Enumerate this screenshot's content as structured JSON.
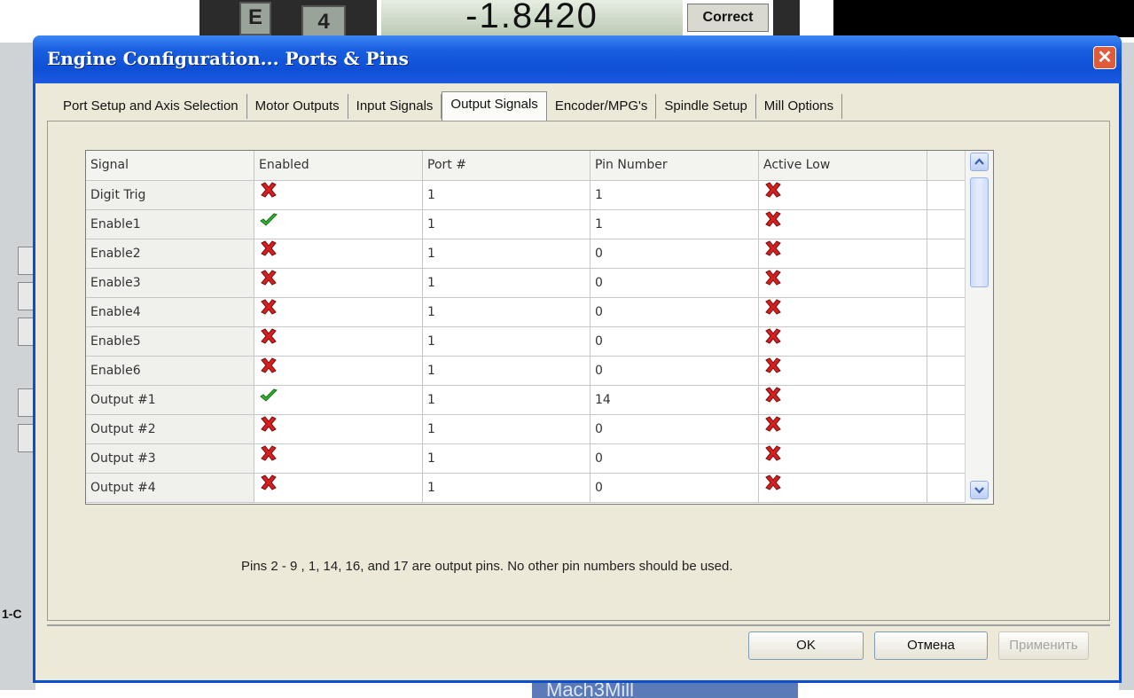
{
  "background_app": {
    "segment_letter": "E",
    "segment_digit": "4",
    "dro_value": "-1.8420",
    "correct_label": "Correct",
    "left_partial_text": "1-C",
    "bottom_label": "Mach3Mill"
  },
  "dialog": {
    "title": "Engine Configuration... Ports & Pins",
    "close_symbol": "✕",
    "tabs": [
      {
        "label": "Port Setup and Axis Selection",
        "active": false
      },
      {
        "label": "Motor Outputs",
        "active": false
      },
      {
        "label": "Input Signals",
        "active": false
      },
      {
        "label": "Output Signals",
        "active": true
      },
      {
        "label": "Encoder/MPG's",
        "active": false
      },
      {
        "label": "Spindle Setup",
        "active": false
      },
      {
        "label": "Mill Options",
        "active": false
      }
    ],
    "grid": {
      "headers": [
        "Signal",
        "Enabled",
        "Port #",
        "Pin Number",
        "Active Low"
      ],
      "rows": [
        {
          "signal": "Digit Trig",
          "enabled": false,
          "port": "1",
          "pin": "1",
          "active_low": false
        },
        {
          "signal": "Enable1",
          "enabled": true,
          "port": "1",
          "pin": "1",
          "active_low": false
        },
        {
          "signal": "Enable2",
          "enabled": false,
          "port": "1",
          "pin": "0",
          "active_low": false
        },
        {
          "signal": "Enable3",
          "enabled": false,
          "port": "1",
          "pin": "0",
          "active_low": false
        },
        {
          "signal": "Enable4",
          "enabled": false,
          "port": "1",
          "pin": "0",
          "active_low": false
        },
        {
          "signal": "Enable5",
          "enabled": false,
          "port": "1",
          "pin": "0",
          "active_low": false
        },
        {
          "signal": "Enable6",
          "enabled": false,
          "port": "1",
          "pin": "0",
          "active_low": false
        },
        {
          "signal": "Output #1",
          "enabled": true,
          "port": "1",
          "pin": "14",
          "active_low": false
        },
        {
          "signal": "Output #2",
          "enabled": false,
          "port": "1",
          "pin": "0",
          "active_low": false
        },
        {
          "signal": "Output #3",
          "enabled": false,
          "port": "1",
          "pin": "0",
          "active_low": false
        },
        {
          "signal": "Output #4",
          "enabled": false,
          "port": "1",
          "pin": "0",
          "active_low": false
        }
      ]
    },
    "note": "Pins 2 - 9 , 1, 14, 16, and 17 are output pins. No  other pin numbers should be used.",
    "buttons": {
      "ok": "OK",
      "cancel": "Отмена",
      "apply": "Применить"
    },
    "colors": {
      "title_bar": "#0e4fd6",
      "check": "#2fb52f",
      "cross": "#d42020"
    }
  }
}
